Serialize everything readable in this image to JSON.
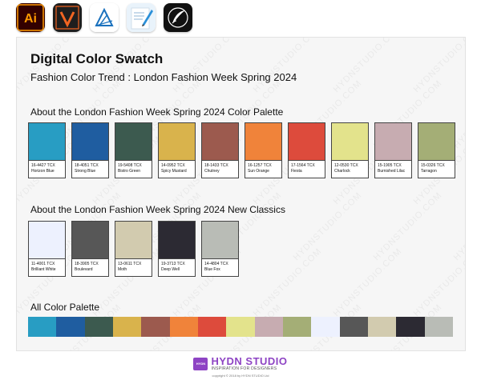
{
  "app_icons": [
    {
      "name": "illustrator",
      "label": "Ai",
      "bg": "#330000",
      "fg": "#ff9a00"
    },
    {
      "name": "vectorstyler",
      "label": "V",
      "bg": "#1e1e1e",
      "fg": "#f26522"
    },
    {
      "name": "affinity-designer",
      "label": "",
      "bg": "#ffffff",
      "fg": "#1b72be"
    },
    {
      "name": "notes-pencil",
      "label": "",
      "bg": "#e9f3fb",
      "fg": "#2a8fd8"
    },
    {
      "name": "procreate",
      "label": "",
      "bg": "#111111",
      "fg": "#ffffff"
    }
  ],
  "swatch": {
    "title": "Digital Color Swatch",
    "subtitle": "Fashion Color Trend : London Fashion Week Spring 2024",
    "palette_heading": "About the London Fashion Week Spring 2024 Color Palette",
    "classics_heading": "About the London Fashion Week Spring 2024 New Classics",
    "all_heading": "All Color Palette",
    "watermark": "HYDNSTUDIO.COM",
    "palette": [
      {
        "code": "16-4427 TCX",
        "name": "Horizon Blue",
        "color": "#289dc3"
      },
      {
        "code": "18-4051 TCX",
        "name": "Strong Blue",
        "color": "#1f5da0"
      },
      {
        "code": "19-5408 TCX",
        "name": "Bistro Green",
        "color": "#3c5a4f"
      },
      {
        "code": "14-0952 TCX",
        "name": "Spicy Mustard",
        "color": "#d9b34c"
      },
      {
        "code": "18-1433 TCX",
        "name": "Chutney",
        "color": "#9c5a4e"
      },
      {
        "code": "16-1257 TCX",
        "name": "Sun Orange",
        "color": "#f0833a"
      },
      {
        "code": "17-1564 TCX",
        "name": "Fiesta",
        "color": "#dd4b3c"
      },
      {
        "code": "12-0530 TCX",
        "name": "Charlock",
        "color": "#e3e38c"
      },
      {
        "code": "15-1905 TCX",
        "name": "Burnished Lilac",
        "color": "#c7acb1"
      },
      {
        "code": "15-0326 TCX",
        "name": "Tarragon",
        "color": "#a4ae76"
      }
    ],
    "classics": [
      {
        "code": "11-4001 TCX",
        "name": "Brilliant White",
        "color": "#edf1fe"
      },
      {
        "code": "18-3905 TCX",
        "name": "Boulevard",
        "color": "#575757"
      },
      {
        "code": "13-0611 TCX",
        "name": "Moth",
        "color": "#d2cbaf"
      },
      {
        "code": "19-3713 TCX",
        "name": "Deep Well",
        "color": "#2c2a33"
      },
      {
        "code": "14-4804 TCX",
        "name": "Blue Fox",
        "color": "#b9bcb6"
      }
    ]
  },
  "brand": {
    "logo_text": "HYDN",
    "name": "HYDN STUDIO",
    "tagline": "INSPIRATION FOR DESIGNERS",
    "copyright": "copyright © 2018 by HYDN STUDIO Ltd",
    "color": "#8e44c4"
  }
}
